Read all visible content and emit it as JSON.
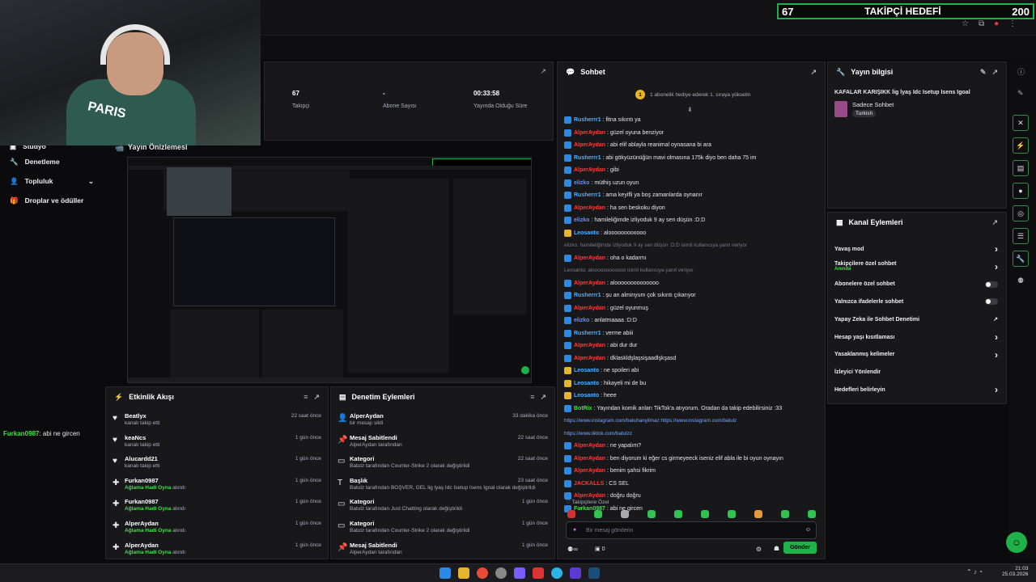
{
  "goal": {
    "current": "67",
    "label": "TAKİPÇİ HEDEFİ",
    "target": "200"
  },
  "webcam": {
    "shirt_text": "PARIS"
  },
  "nav": {
    "items": [
      {
        "label": "Stüdyo"
      },
      {
        "label": "Denetleme"
      },
      {
        "label": "Topluluk"
      },
      {
        "label": "Droplar ve ödüller"
      }
    ]
  },
  "left_chat": {
    "user": "Furkan0987",
    "text": ": abi ne gircen"
  },
  "stats": [
    {
      "value": "67",
      "label": "Takipçi"
    },
    {
      "value": "-",
      "label": "Abone Sayısı"
    },
    {
      "value": "00:33:58",
      "label": "Yayında Olduğu Süre"
    }
  ],
  "preview": {
    "title": "Yayın Önizlemesi"
  },
  "activity": {
    "title": "Etkinlik Akışı",
    "items": [
      {
        "name": "Beatlyx",
        "desc": "kanalı takip etti",
        "highlight": "",
        "time": "22 saat önce",
        "icon": "heart"
      },
      {
        "name": "keaNcs",
        "desc": "kanalı takip etti",
        "highlight": "",
        "time": "1 gün önce",
        "icon": "heart"
      },
      {
        "name": "Alucardd21",
        "desc": "kanalı takip etti",
        "highlight": "",
        "time": "1 gün önce",
        "icon": "heart"
      },
      {
        "name": "Furkan0987",
        "desc": "alındı",
        "highlight": "Ağlama Hadi Oyna",
        "time": "1 gün önce",
        "icon": "puzzle"
      },
      {
        "name": "Furkan0987",
        "desc": "alındı",
        "highlight": "Ağlama Hadi Oyna",
        "time": "1 gün önce",
        "icon": "puzzle"
      },
      {
        "name": "AlperAydan",
        "desc": "alındı",
        "highlight": "Ağlama Hadi Oyna",
        "time": "1 gün önce",
        "icon": "puzzle"
      },
      {
        "name": "AlperAydan",
        "desc": "alındı",
        "highlight": "Ağlama Hadi Oyna",
        "time": "1 gün önce",
        "icon": "puzzle"
      }
    ]
  },
  "modactions": {
    "title": "Denetim Eylemleri",
    "items": [
      {
        "name": "AlperAydan",
        "desc": "bir mesajı sildi",
        "time": "33 dakika önce",
        "icon": "user"
      },
      {
        "name": "Mesaj Sabitlendi",
        "desc": "AlperAydan tarafından",
        "time": "22 saat önce",
        "icon": "pin"
      },
      {
        "name": "Kategori",
        "desc": "Batulz tarafından Counter-Strike 2 olarak değiştirildi",
        "time": "22 saat önce",
        "icon": "folder"
      },
      {
        "name": "Başlık",
        "desc": "Batulz tarafından BOŞVER, GEL lig lyaş Idc Isetup Isens Igoal olarak değiştirildi",
        "time": "23 saat önce",
        "icon": "title"
      },
      {
        "name": "Kategori",
        "desc": "Batulz tarafından Just Chatting olarak değiştirildi",
        "time": "1 gün önce",
        "icon": "folder"
      },
      {
        "name": "Kategori",
        "desc": "Batulz tarafından Counter-Strike 2 olarak değiştirildi",
        "time": "1 gün önce",
        "icon": "folder"
      },
      {
        "name": "Mesaj Sabitlendi",
        "desc": "AlperAydan tarafından",
        "time": "1 gün önce",
        "icon": "pin"
      }
    ]
  },
  "chat": {
    "title": "Sohbet",
    "gift_banner": "1 abonelik hediye ederek 1. sıraya yükselin",
    "messages": [
      {
        "user": "Rusherrr1",
        "text": ": fitna sıkıntı ya",
        "color": "#49b1ff"
      },
      {
        "user": "AlperAydan",
        "text": ": güzel oyuna benziyor",
        "color": "#ff3a3a"
      },
      {
        "user": "AlperAydan",
        "text": ": abi elif ablayla reanimal oynasana bi ara",
        "color": "#ff3a3a"
      },
      {
        "user": "Rusherrr1",
        "text": ": abi gökyüzünüğün mavi olmasına 175k diyo ben daha 75 im",
        "color": "#49b1ff"
      },
      {
        "user": "AlperAydan",
        "text": ": gibi",
        "color": "#ff3a3a"
      },
      {
        "user": "elizko",
        "text": ": müthiş uzun oyun",
        "color": "#6a8cff"
      },
      {
        "user": "Rusherrr1",
        "text": ": ama keyifli ya boş zamanlarda oynanır",
        "color": "#49b1ff"
      },
      {
        "user": "AlperAydan",
        "text": ": ha sen beskoku diyon",
        "color": "#ff3a3a"
      },
      {
        "user": "elizko",
        "text": ": hamileliğimde izliyoduk 9 ay sen düşün :D:D",
        "color": "#6a8cff"
      },
      {
        "user": "Leosanto",
        "text": ": aloooooooooooo",
        "color": "#49b1ff"
      },
      {
        "user": "",
        "text": "elizko: hamileliğimde izliyoduk 9 ay sen düşün :D:D isimli kullanıcıya yanıt veriyor",
        "color": "#7a7a85"
      },
      {
        "user": "AlperAydan",
        "text": ": oha o kadarmı",
        "color": "#ff3a3a"
      },
      {
        "user": "",
        "text": "Leosanto: aloooooooooooo isimli kullanıcıya yanıt veriyor",
        "color": "#7a7a85"
      },
      {
        "user": "AlperAydan",
        "text": ": aloooooooooooooo",
        "color": "#ff3a3a"
      },
      {
        "user": "Rusherrr1",
        "text": ": şu an alminyum çok sıkıntı çıkarıyor",
        "color": "#49b1ff"
      },
      {
        "user": "AlperAydan",
        "text": ": güzel oyunmuş",
        "color": "#ff3a3a"
      },
      {
        "user": "elizko",
        "text": ": anlatmaaaa :D:D",
        "color": "#6a8cff"
      },
      {
        "user": "Rusherrr1",
        "text": ": verme abiii",
        "color": "#49b1ff"
      },
      {
        "user": "AlperAydan",
        "text": ": abi dur dur",
        "color": "#ff3a3a"
      },
      {
        "user": "AlperAydan",
        "text": ": dklaskldşlaşsişaadlşkşasd",
        "color": "#ff3a3a"
      },
      {
        "user": "Leosanto",
        "text": ": ne spoileri abi",
        "color": "#49b1ff"
      },
      {
        "user": "Leosanto",
        "text": ": hikayeli mi de bu",
        "color": "#49b1ff"
      },
      {
        "user": "Leosanto",
        "text": ": heee",
        "color": "#49b1ff"
      },
      {
        "user": "BotRix",
        "text": ": Yayından komik anları TikTok'a atıyorum. Oradan da takip edebilirsiniz :33",
        "color": "#3fe048"
      },
      {
        "user": "",
        "text": "https://www.instagram.com/batuhanyilmaz  https://www.instagram.com/batulz",
        "color": "#7aa8ff"
      },
      {
        "user": "",
        "text": "https://www.tiktok.com/batulzz",
        "color": "#7aa8ff"
      },
      {
        "user": "AlperAydan",
        "text": ": ne yapalım?",
        "color": "#ff3a3a"
      },
      {
        "user": "AlperAydan",
        "text": ": ben diyorum ki eğer cs girmeyeeck iseniz elif abla ile bi oyun oynayın",
        "color": "#ff3a3a"
      },
      {
        "user": "AlperAydan",
        "text": ": benim şahsi fikrim",
        "color": "#ff3a3a"
      },
      {
        "user": "JACKALLS",
        "text": ": CS SEL",
        "color": "#ff3a3a"
      },
      {
        "user": "AlperAydan",
        "text": ": doğru doğru",
        "color": "#ff3a3a"
      },
      {
        "user": "Furkan0987",
        "text": ": abi ne gircen",
        "color": "#3fe048"
      }
    ],
    "followers_only": "Takipçilere Özel",
    "input_placeholder": "Bir mesaj gönderin",
    "count": "0",
    "send": "Gönder"
  },
  "stream_info": {
    "title": "Yayın bilgisi",
    "stream_title": "KAFALAR KARIŞIKK lig lyaş Idc Isetup Isens Igoal",
    "category": "Sadece Sohbet",
    "language": "Turkish"
  },
  "channel_actions": {
    "title": "Kanal Eylemleri",
    "items": [
      {
        "label": "Yavaş mod",
        "sub": "",
        "control": "chevron"
      },
      {
        "label": "Takipçilere özel sohbet",
        "sub": "Anında",
        "control": "chevron"
      },
      {
        "label": "Abonelere özel sohbet",
        "sub": "",
        "control": "toggle"
      },
      {
        "label": "Yalnızca ifadelerle sohbet",
        "sub": "",
        "control": "toggle"
      },
      {
        "label": "Yapay Zeka ile Sohbet Denetimi",
        "sub": "",
        "control": "external"
      },
      {
        "label": "Hesap yaşı kısıtlaması",
        "sub": "",
        "control": "chevron"
      },
      {
        "label": "Yasaklanmış kelimeler",
        "sub": "",
        "control": "chevron"
      },
      {
        "label": "İzleyici Yönlendir",
        "sub": "",
        "control": "none"
      },
      {
        "label": "Hedefleri belirleyin",
        "sub": "",
        "control": "chevron"
      }
    ]
  },
  "taskbar": {
    "time": "21:03",
    "date": "25.03.2026"
  },
  "colors": {
    "accent": "#1fb24a",
    "bg": "#0b0b0d",
    "panel": "#18181b"
  }
}
